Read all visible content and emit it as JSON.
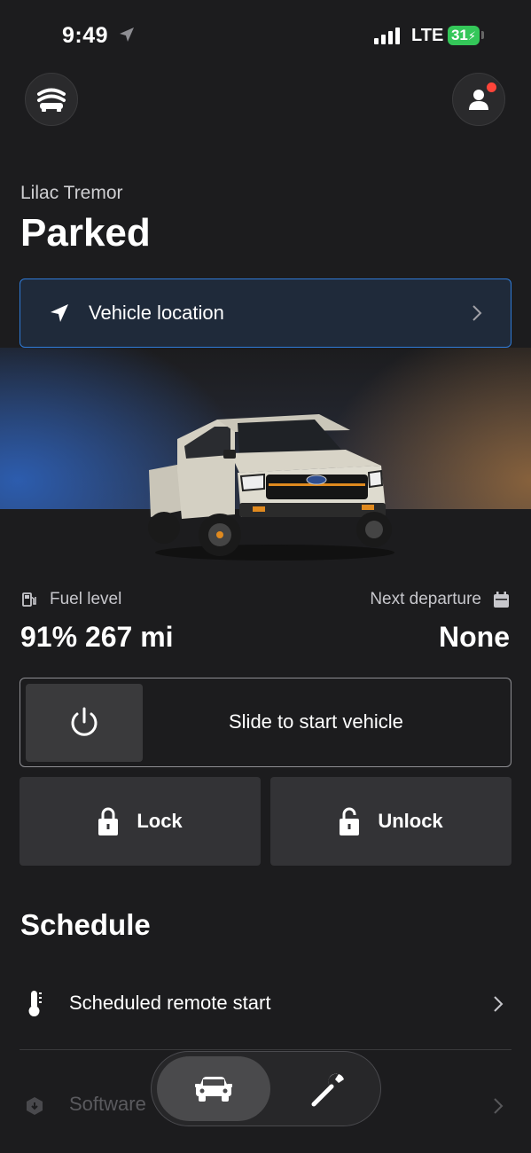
{
  "status_bar": {
    "time": "9:49",
    "network": "LTE",
    "battery": "31"
  },
  "header": {
    "menu_icon": "garage-icon",
    "profile_icon": "profile-icon"
  },
  "vehicle": {
    "name": "Lilac Tremor",
    "status": "Parked"
  },
  "location": {
    "label": "Vehicle location",
    "icon": "location-arrow-icon"
  },
  "stats": {
    "fuel_label": "Fuel level",
    "fuel_value": "91% 267 mi",
    "departure_label": "Next departure",
    "departure_value": "None"
  },
  "controls": {
    "slide_label": "Slide to start vehicle",
    "lock_label": "Lock",
    "unlock_label": "Unlock"
  },
  "schedule": {
    "title": "Schedule",
    "items": [
      {
        "label": "Scheduled remote start",
        "icon": "thermometer-icon"
      },
      {
        "label": "Software",
        "icon": "software-update-icon"
      }
    ]
  },
  "tabbar": {
    "tabs": [
      "vehicle-tab",
      "service-tab"
    ],
    "active": "vehicle-tab"
  },
  "colors": {
    "accent": "#2f7bd8",
    "battery": "#34c759",
    "notification": "#ff453a"
  }
}
